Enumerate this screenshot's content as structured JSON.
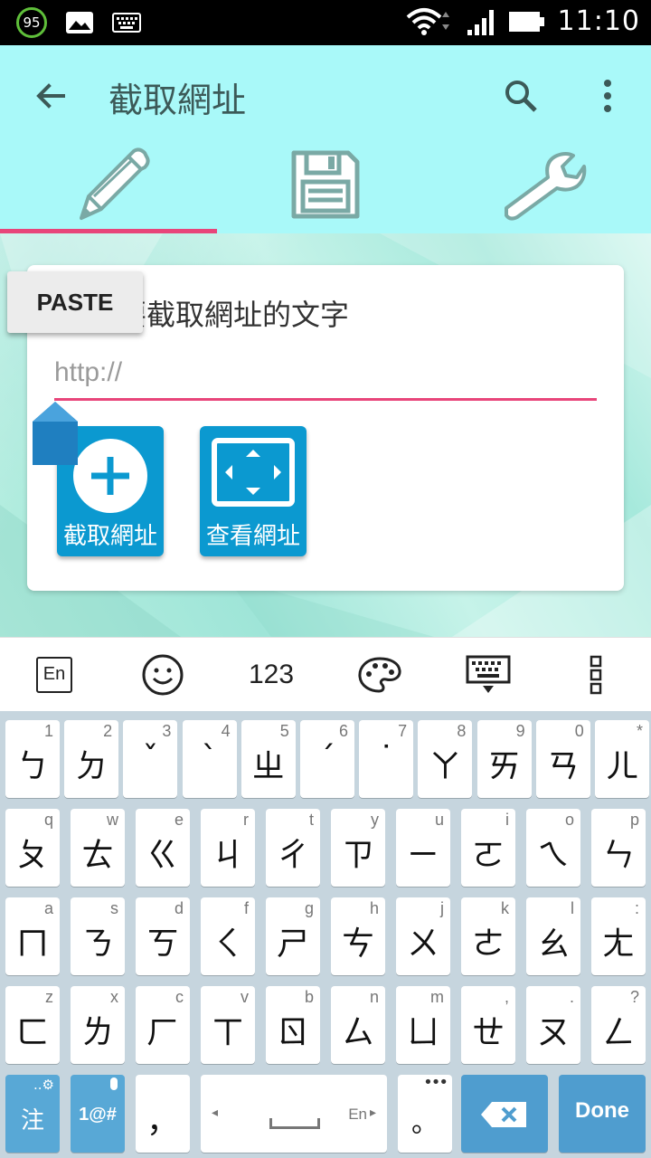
{
  "status_bar": {
    "battery_badge": "95",
    "time": "11:10",
    "icons": [
      "battery-saver-icon",
      "image-icon",
      "keyboard-icon",
      "wifi-icon",
      "signal-icon",
      "battery-icon"
    ]
  },
  "app_bar": {
    "title": "截取網址",
    "back_icon": "arrow-back-icon",
    "search_icon": "search-icon",
    "more_icon": "more-vert-icon"
  },
  "tabs": [
    {
      "icon": "pencil-icon",
      "active": true
    },
    {
      "icon": "floppy-disk-icon",
      "active": false
    },
    {
      "icon": "wrench-icon",
      "active": false
    }
  ],
  "card": {
    "hint": "要截取網址的文字",
    "input_value": "",
    "input_placeholder": "http://",
    "buttons": [
      {
        "label": "截取網址",
        "icon": "add-circle-icon"
      },
      {
        "label": "查看網址",
        "icon": "fullscreen-icon"
      }
    ]
  },
  "paste_popup": {
    "label": "PASTE"
  },
  "keyboard_toolbar": {
    "lang_label": "En",
    "numbers_label": "123",
    "icons": [
      "language-icon",
      "emoji-icon",
      "palette-icon",
      "hide-keyboard-icon",
      "more-vert-icon"
    ]
  },
  "keyboard": {
    "rows": [
      [
        {
          "main": "ㄅ",
          "sub": "1"
        },
        {
          "main": "ㄉ",
          "sub": "2"
        },
        {
          "main": "ˇ",
          "sub": "3"
        },
        {
          "main": "ˋ",
          "sub": "4"
        },
        {
          "main": "ㄓ",
          "sub": "5"
        },
        {
          "main": "ˊ",
          "sub": "6"
        },
        {
          "main": "˙",
          "sub": "7"
        },
        {
          "main": "ㄚ",
          "sub": "8"
        },
        {
          "main": "ㄞ",
          "sub": "9"
        },
        {
          "main": "ㄢ",
          "sub": "0"
        },
        {
          "main": "ㄦ",
          "sub": "*"
        }
      ],
      [
        {
          "main": "ㄆ",
          "sub": "q"
        },
        {
          "main": "ㄊ",
          "sub": "w"
        },
        {
          "main": "ㄍ",
          "sub": "e"
        },
        {
          "main": "ㄐ",
          "sub": "r"
        },
        {
          "main": "ㄔ",
          "sub": "t"
        },
        {
          "main": "ㄗ",
          "sub": "y"
        },
        {
          "main": "ㄧ",
          "sub": "u"
        },
        {
          "main": "ㄛ",
          "sub": "i"
        },
        {
          "main": "ㄟ",
          "sub": "o"
        },
        {
          "main": "ㄣ",
          "sub": "p"
        }
      ],
      [
        {
          "main": "ㄇ",
          "sub": "a"
        },
        {
          "main": "ㄋ",
          "sub": "s"
        },
        {
          "main": "ㄎ",
          "sub": "d"
        },
        {
          "main": "ㄑ",
          "sub": "f"
        },
        {
          "main": "ㄕ",
          "sub": "g"
        },
        {
          "main": "ㄘ",
          "sub": "h"
        },
        {
          "main": "ㄨ",
          "sub": "j"
        },
        {
          "main": "ㄜ",
          "sub": "k"
        },
        {
          "main": "ㄠ",
          "sub": "l"
        },
        {
          "main": "ㄤ",
          "sub": ":"
        }
      ],
      [
        {
          "main": "ㄈ",
          "sub": "z"
        },
        {
          "main": "ㄌ",
          "sub": "x"
        },
        {
          "main": "ㄏ",
          "sub": "c"
        },
        {
          "main": "ㄒ",
          "sub": "v"
        },
        {
          "main": "ㄖ",
          "sub": "b"
        },
        {
          "main": "ㄙ",
          "sub": "n"
        },
        {
          "main": "ㄩ",
          "sub": "m"
        },
        {
          "main": "ㄝ",
          "sub": ","
        },
        {
          "main": "ㄡ",
          "sub": "."
        },
        {
          "main": "ㄥ",
          "sub": "?"
        }
      ]
    ],
    "bottom": {
      "lang_key": "注",
      "symbols_key": "1@#",
      "comma_key": "，",
      "space_lang": "En",
      "period_key": "。",
      "done_key": "Done"
    }
  }
}
